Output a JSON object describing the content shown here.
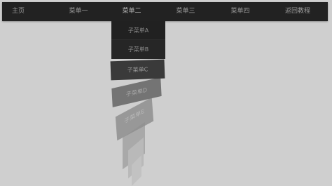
{
  "nav": {
    "items": [
      "主页",
      "菜单一",
      "菜单二",
      "菜单三",
      "菜单四",
      "返回教程"
    ]
  },
  "submenu": {
    "items": [
      "子菜单A",
      "子菜单B",
      "子菜单C",
      "子菜单D",
      "子菜单E"
    ]
  },
  "colors": {
    "background": "#cfcfcf",
    "navbar": "#222222",
    "nav_text": "#9a9a9a"
  }
}
